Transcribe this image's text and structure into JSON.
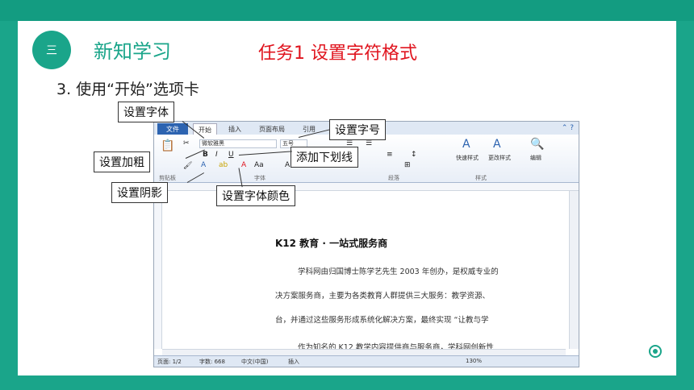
{
  "slide": {
    "section_badge": "三",
    "section_title": "新知学习",
    "task_title": "任务1  设置字符格式",
    "subtitle": "3. 使用“开始”选项卡"
  },
  "word": {
    "tabs": [
      "文件",
      "开始",
      "插入",
      "页面布局",
      "引用"
    ],
    "font_name": "微软雅黑",
    "font_size": "五号",
    "groups": [
      "剪贴板",
      "字体",
      "段落",
      "样式",
      "编辑"
    ],
    "styles": [
      "快速样式",
      "更改样式"
    ],
    "edit_label": "编辑",
    "doc_heading": "K12 教育 · 一站式服务商",
    "doc_lines": [
      "学科网由归国博士陈学艺先生 2003 年创办，是权威专业的",
      "决方案服务商，主要为各类教育人群提供三大服务：教学资源、",
      "台，并通过这些服务形成系统化解决方案，最终实现 “让教与学",
      "作为知名的 K12 教学内容提供商与服务商，学科网创新性"
    ],
    "status": {
      "page": "页面: 1/2",
      "words": "字数: 668",
      "lang": "中文(中国)",
      "mode": "插入",
      "zoom": "130%"
    }
  },
  "callouts": {
    "font": "设置字体",
    "font_size": "设置字号",
    "bold": "设置加粗",
    "underline": "添加下划线",
    "shadow": "设置阴影",
    "font_color": "设置字体颜色"
  }
}
